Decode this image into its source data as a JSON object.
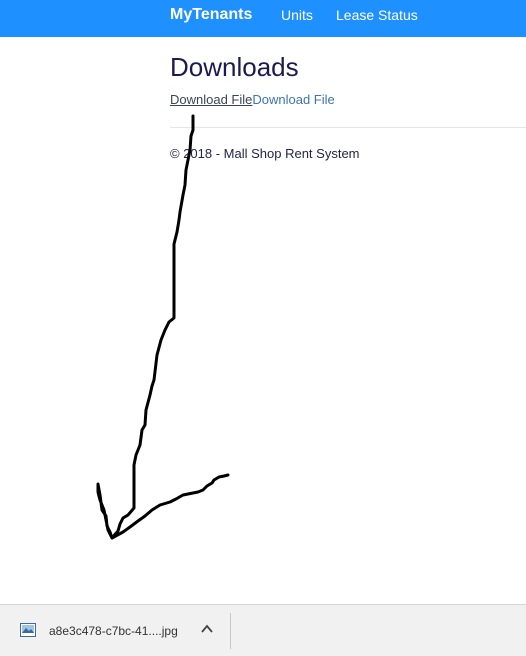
{
  "nav": {
    "brand": "MyTenants",
    "items": [
      {
        "label": "Units"
      },
      {
        "label": "Lease Status"
      }
    ]
  },
  "main": {
    "title": "Downloads",
    "links": [
      "Download File",
      "Download File"
    ],
    "footer": "© 2018 - Mall Shop Rent System"
  },
  "download_shelf": {
    "file_name": "a8e3c478-c7bc-41....jpg",
    "file_icon": "image-file-icon",
    "menu_icon": "chevron-up-icon"
  },
  "colors": {
    "navbar": "#1e90ff",
    "title": "#1b1b4f",
    "link": "#3d74b1",
    "stroke": "#000000"
  }
}
